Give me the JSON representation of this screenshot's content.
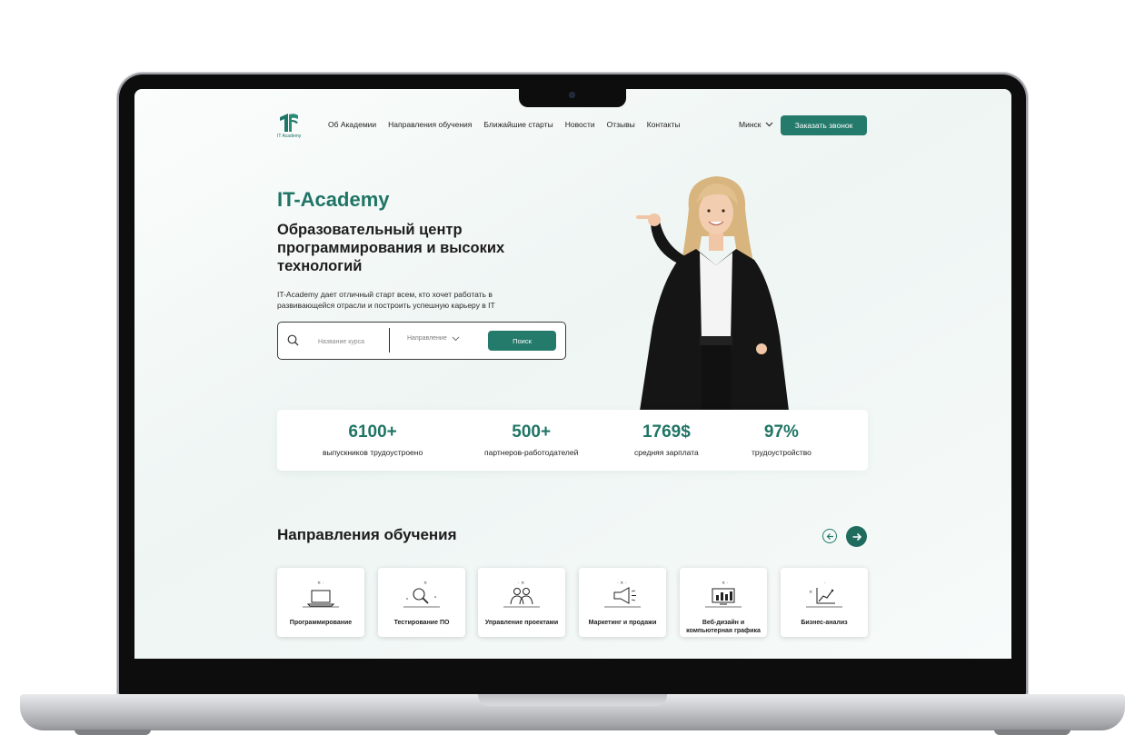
{
  "header": {
    "logo_caption": "IT Academy",
    "nav": [
      "Об Академии",
      "Направления обучения",
      "Ближайшие старты",
      "Новости",
      "Отзывы",
      "Контакты"
    ],
    "city": "Минск",
    "call_button": "Заказать звонок"
  },
  "hero": {
    "brand": "IT-Academy",
    "title": "Образовательный центр программирования и высоких технологий",
    "description": "IT-Academy дает отличный старт всем, кто хочет работать в развивающейся отрасли и построить успешную карьеру в IT",
    "search": {
      "course_placeholder": "Название курса",
      "direction_label": "Направление",
      "button": "Поиск"
    }
  },
  "stats": [
    {
      "value": "6100+",
      "label": "выпускников трудоустроено"
    },
    {
      "value": "500+",
      "label": "партнеров-работодателей"
    },
    {
      "value": "1769$",
      "label": "средняя зарплата"
    },
    {
      "value": "97%",
      "label": "трудоустройство"
    }
  ],
  "directions": {
    "title": "Направления обучения",
    "items": [
      {
        "label": "Программирование",
        "icon": "laptop-icon"
      },
      {
        "label": "Тестирование ПО",
        "icon": "magnifier-icon"
      },
      {
        "label": "Управление проектами",
        "icon": "team-icon"
      },
      {
        "label": "Маркетинг и продажи",
        "icon": "megaphone-icon"
      },
      {
        "label": "Веб-дизайн и компьютерная графика",
        "icon": "monitor-chart-icon"
      },
      {
        "label": "Бизнес-анализ",
        "icon": "growth-chart-icon"
      }
    ]
  },
  "colors": {
    "accent": "#247a6b",
    "accent_dark": "#1f6b5e",
    "text": "#1c1c1c"
  }
}
